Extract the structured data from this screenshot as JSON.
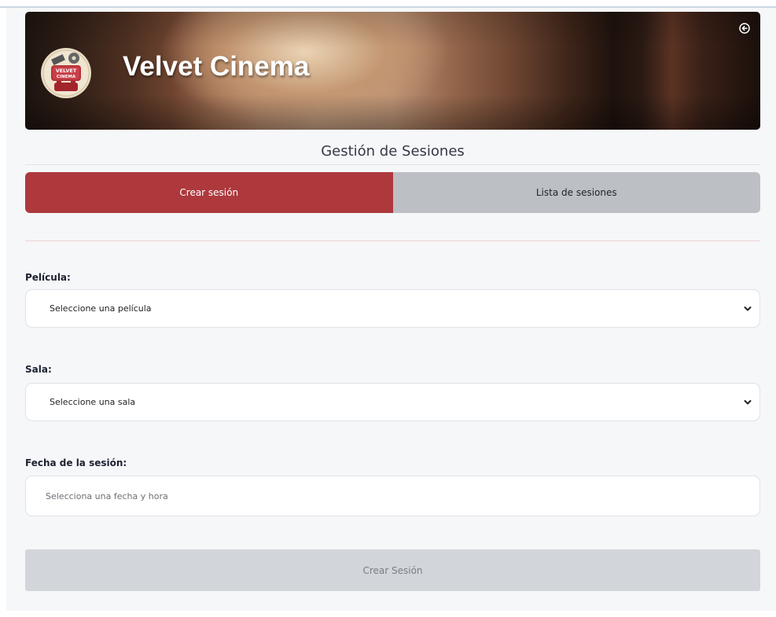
{
  "header": {
    "brand": "Velvet Cinema",
    "logo_text_line1": "VELVET",
    "logo_text_line2": "CINEMA",
    "logout_icon": "arrow-left-circle-icon"
  },
  "page": {
    "section_title": "Gestión de Sesiones"
  },
  "tabs": [
    {
      "label": "Crear sesión",
      "active": true
    },
    {
      "label": "Lista de sesiones",
      "active": false
    }
  ],
  "form": {
    "movie": {
      "label": "Película:",
      "selected": "Seleccione una película"
    },
    "room": {
      "label": "Sala:",
      "selected": "Seleccione una sala"
    },
    "datetime": {
      "label": "Fecha de la sesión:",
      "placeholder": "Selecciona una fecha y hora"
    },
    "submit_label": "Crear Sesión"
  },
  "colors": {
    "accent": "#ad393d",
    "inactive_tab": "#bcc0c5",
    "disabled_button": "#d2d5d9"
  }
}
